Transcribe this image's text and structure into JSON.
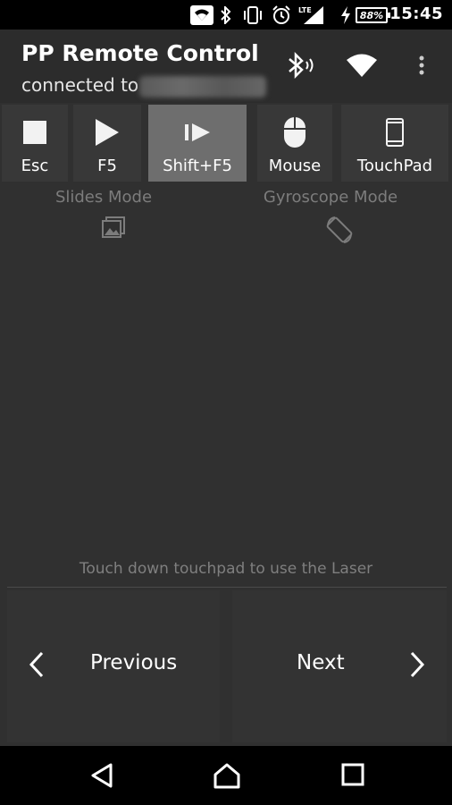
{
  "status_bar": {
    "time": "15:45",
    "battery": "88%",
    "network": "LTE",
    "icons": [
      "wifi-signal-icon",
      "bluetooth-icon",
      "vibrate-icon",
      "alarm-icon",
      "cell-signal-icon",
      "charging-icon",
      "battery-icon"
    ]
  },
  "app_bar": {
    "title": "PP Remote Control",
    "subtitle": "connected to",
    "actions": [
      "bluetooth-connection-icon",
      "wifi-icon",
      "overflow-menu-icon"
    ]
  },
  "modes": [
    {
      "label": "Esc",
      "icon": "stop-icon"
    },
    {
      "label": "F5",
      "icon": "play-icon"
    },
    {
      "label": "Shift+F5",
      "icon": "play-from-current-icon",
      "active": true
    },
    {
      "label": "Mouse",
      "icon": "mouse-icon"
    },
    {
      "label": "TouchPad",
      "icon": "phone-icon"
    }
  ],
  "captions": {
    "slides_mode": "Slides Mode",
    "gyroscope_mode": "Gyroscope Mode"
  },
  "hint": "Touch down touchpad to use the Laser",
  "navigation": {
    "previous": "Previous",
    "next": "Next"
  },
  "colors": {
    "background": "#303030",
    "active_button": "#6e6e6e",
    "button": "#383838",
    "muted_text": "#7c7c7c"
  }
}
